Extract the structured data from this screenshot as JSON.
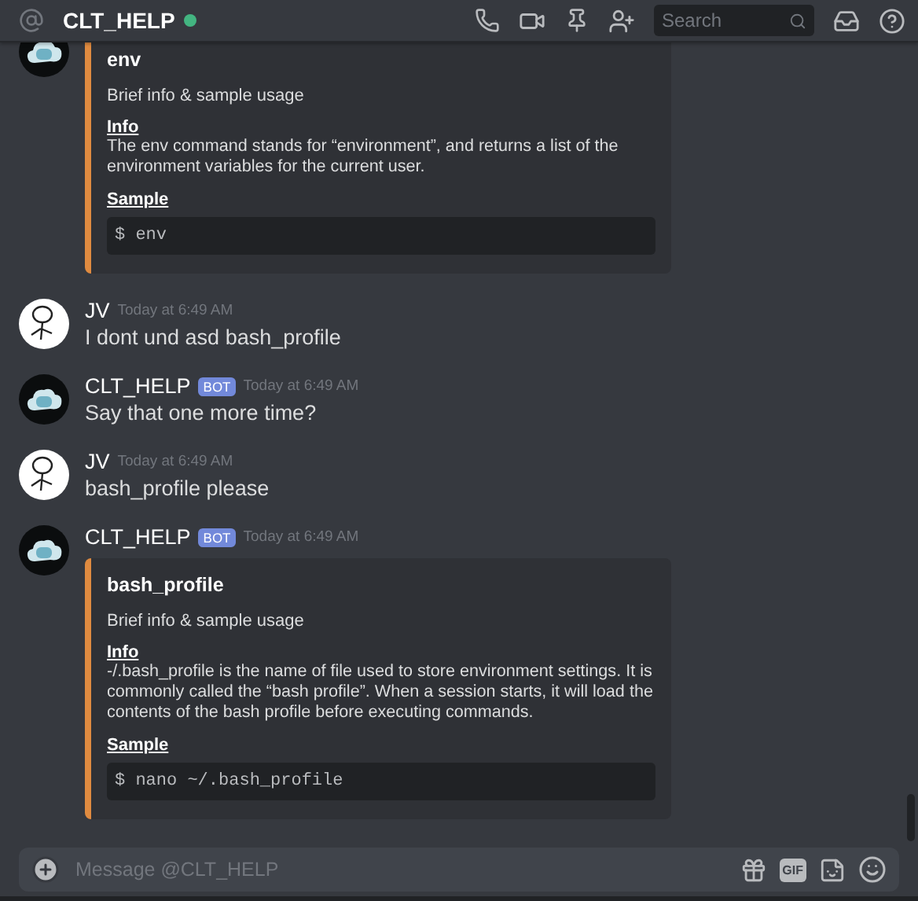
{
  "channel": {
    "name": "CLT_HELP",
    "online": true
  },
  "search": {
    "placeholder": "Search"
  },
  "messages": [
    {
      "kind": "bot",
      "embed": {
        "title": "env",
        "description": "Brief info & sample usage",
        "info_heading": "Info",
        "info_text": "The env command stands for “environment”, and returns a list of the environment variables for the current user.",
        "sample_heading": "Sample",
        "code": "$ env"
      }
    },
    {
      "kind": "user",
      "author": "JV",
      "bot": false,
      "time": "Today at 6:49 AM",
      "text": "I dont und asd bash_profile"
    },
    {
      "kind": "bot",
      "author": "CLT_HELP",
      "bot": true,
      "bot_label": "BOT",
      "time": "Today at 6:49 AM",
      "text": "Say that one more time?"
    },
    {
      "kind": "user",
      "author": "JV",
      "bot": false,
      "time": "Today at 6:49 AM",
      "text": "bash_profile please"
    },
    {
      "kind": "bot",
      "author": "CLT_HELP",
      "bot": true,
      "bot_label": "BOT",
      "time": "Today at 6:49 AM",
      "embed": {
        "title": "bash_profile",
        "description": "Brief info & sample usage",
        "info_heading": "Info",
        "info_text": "-/.bash_profile is the name of file used to store environment settings. It is commonly called the “bash profile”. When a session starts, it will load the contents of the bash profile before executing commands.",
        "sample_heading": "Sample",
        "code": "$ nano ~/.bash_profile"
      }
    }
  ],
  "composer": {
    "placeholder": "Message @CLT_HELP",
    "gif_label": "GIF"
  }
}
